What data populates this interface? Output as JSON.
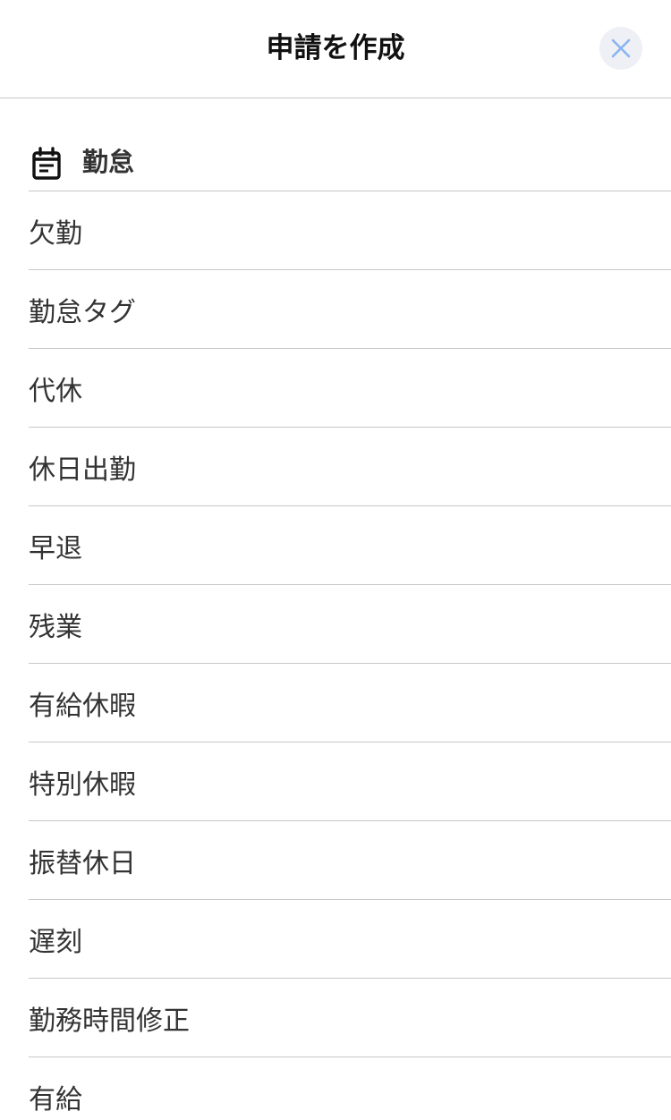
{
  "header": {
    "title": "申請を作成",
    "close_icon": "close-icon"
  },
  "colors": {
    "close_icon": "#8ab4f0",
    "close_bg": "#eef0f5",
    "divider": "#c8c8c8",
    "text": "#333333"
  },
  "section": {
    "icon": "calendar-icon",
    "title": "勤怠",
    "items": [
      {
        "label": "欠勤"
      },
      {
        "label": "勤怠タグ"
      },
      {
        "label": "代休"
      },
      {
        "label": "休日出勤"
      },
      {
        "label": "早退"
      },
      {
        "label": "残業"
      },
      {
        "label": "有給休暇"
      },
      {
        "label": "特別休暇"
      },
      {
        "label": "振替休日"
      },
      {
        "label": "遅刻"
      },
      {
        "label": "勤務時間修正"
      },
      {
        "label": "有給"
      }
    ]
  }
}
